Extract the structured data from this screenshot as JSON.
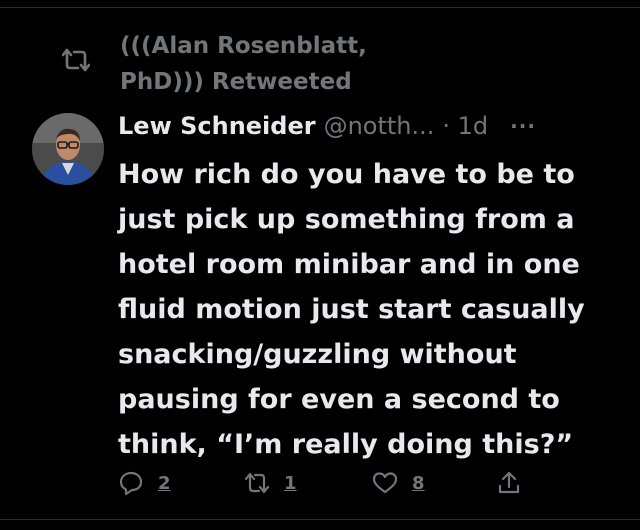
{
  "retweet": {
    "icon": "retweet-icon",
    "retweeter_text": "(((Alan Rosenblatt, PhD))) Retweeted"
  },
  "tweet": {
    "avatar": "avatar",
    "author_name": "Lew Schneider",
    "author_handle": "@notth...",
    "time": "· 1d",
    "more_icon": "···",
    "text": "How rich do you have to be to just pick up something from a hotel room minibar and in one fluid motion just start casually snacking/guzzling without pausing for even a second to think, “I’m really doing this?”"
  },
  "actions": {
    "reply_count": "2",
    "retweet_count": "1",
    "like_count": "8"
  },
  "colors": {
    "background": "#000000",
    "primary_text": "#e7e9ea",
    "secondary_text": "#71767b"
  }
}
